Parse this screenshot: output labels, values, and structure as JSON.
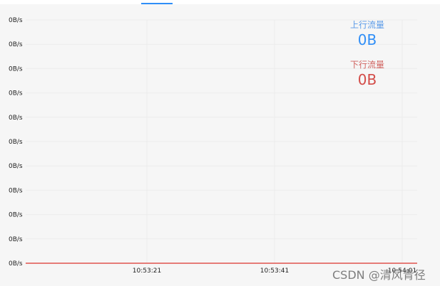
{
  "chart_data": {
    "type": "line",
    "x": [
      "10:53:21",
      "10:53:41",
      "10:54:01"
    ],
    "y_ticks": [
      "0B/s",
      "0B/s",
      "0B/s",
      "0B/s",
      "0B/s",
      "0B/s",
      "0B/s",
      "0B/s",
      "0B/s",
      "0B/s",
      "0B/s"
    ],
    "series": [
      {
        "name": "上行流量",
        "values": [
          0,
          0,
          0
        ],
        "color": "#2f8ef7"
      },
      {
        "name": "下行流量",
        "values": [
          0,
          0,
          0
        ],
        "color": "#e0524d"
      }
    ],
    "grid": true,
    "legend_position": "top-right"
  },
  "legend": {
    "upload_label": "上行流量",
    "upload_value": "0B",
    "download_label": "下行流量",
    "download_value": "0B"
  },
  "watermark": "CSDN @清风青径",
  "colors": {
    "upload": "#2f8ef7",
    "download": "#e0524d",
    "tab_indicator": "#2f8ef7"
  }
}
